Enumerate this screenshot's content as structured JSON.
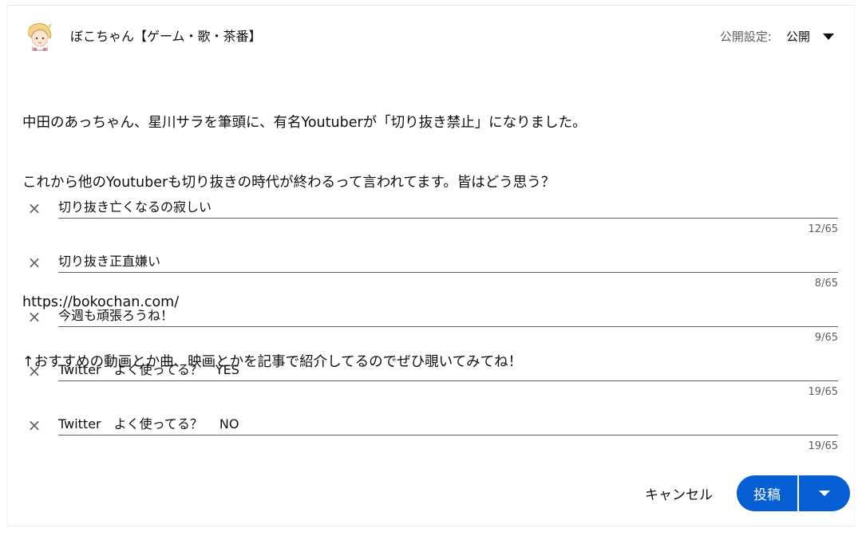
{
  "header": {
    "channel_name": "ぼこちゃん【ゲーム・歌・茶番】",
    "visibility_label": "公開設定:",
    "visibility_value": "公開"
  },
  "post": {
    "lines": [
      "中田のあっちゃん、星川サラを筆頭に、有名Youtuberが「切り抜き禁止」になりました。",
      "これから他のYoutuberも切り抜きの時代が終わるって言われてます。皆はどう思う？",
      "",
      "https://bokochan.com/",
      "↑おすすめの動画とか曲、映画とかを記事で紹介してるのでぜひ覗いてみてね！"
    ]
  },
  "poll": {
    "remove_glyph": "×",
    "options": [
      {
        "text": "切り抜き亡くなるの寂しい",
        "count": "12/65"
      },
      {
        "text": "切り抜き正直嫌い",
        "count": "8/65"
      },
      {
        "text": "今週も頑張ろうね！",
        "count": "9/65"
      },
      {
        "text": "Twitter　よく使ってる？　YES",
        "count": "19/65"
      },
      {
        "text": "Twitter　よく使ってる？　 NO",
        "count": "19/65"
      }
    ]
  },
  "actions": {
    "cancel_label": "キャンセル",
    "post_label": "投稿"
  },
  "colors": {
    "accent": "#065fd4",
    "secondary_text": "#606060"
  },
  "icons": {
    "avatar": "avatar-illustration",
    "remove": "close-icon",
    "visibility_dropdown": "caret-down-icon",
    "post_menu": "caret-down-icon"
  }
}
